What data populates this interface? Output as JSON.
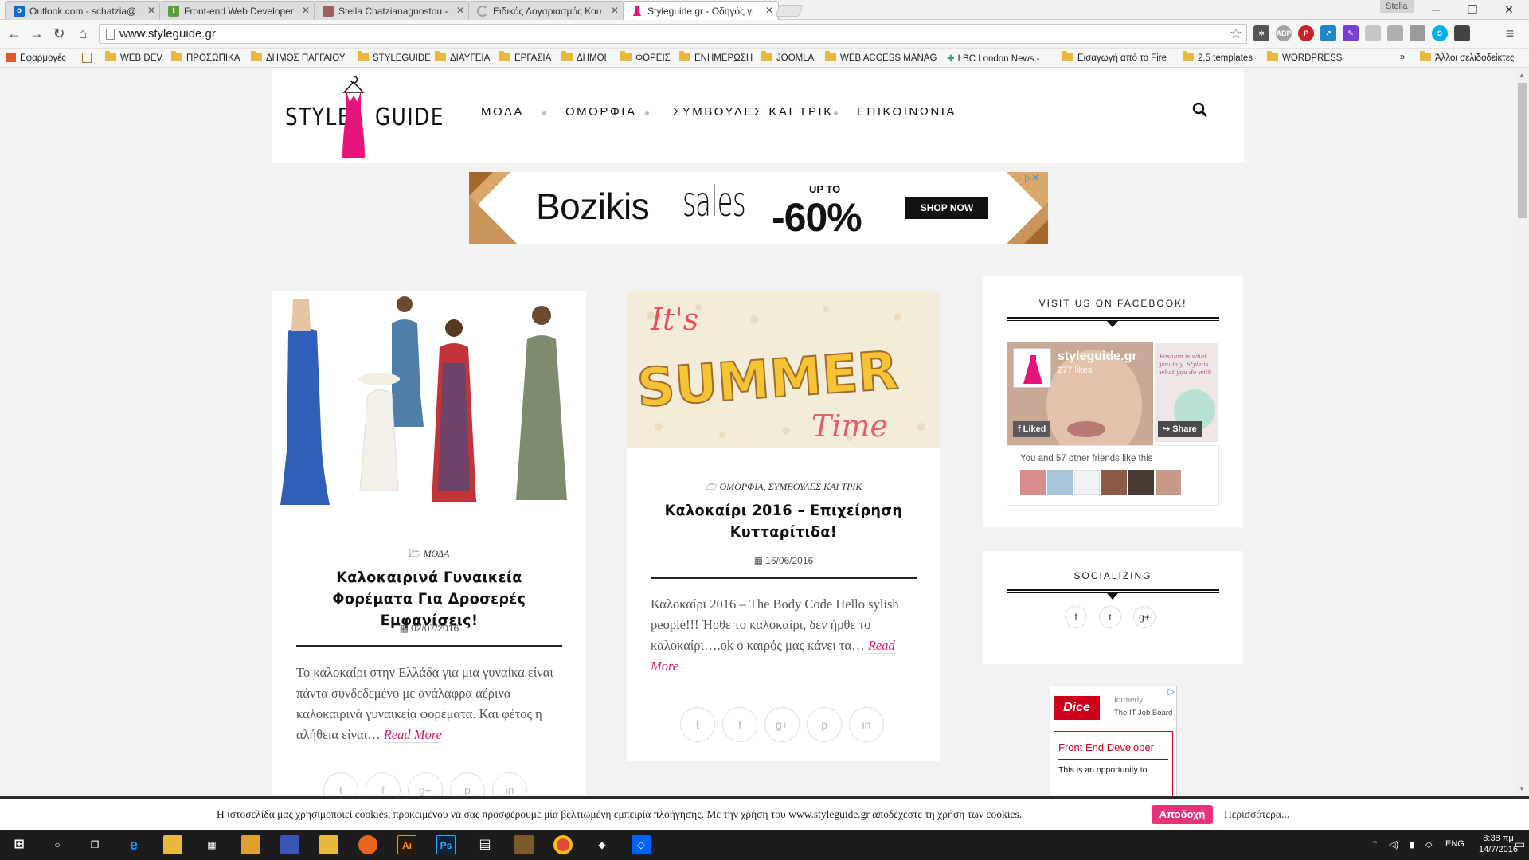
{
  "browser": {
    "tabs": [
      {
        "title": "Outlook.com - schatzia@",
        "fav_color": "#0a6ad0",
        "fav_glyph": "o"
      },
      {
        "title": "Front-end Web Developer",
        "fav_color": "#5a9e3a",
        "fav_glyph": "t"
      },
      {
        "title": "Stella Chatzianagnostou -",
        "fav_color": "#a06060",
        "fav_glyph": ""
      },
      {
        "title": "Ειδικός Λογαριασμός Κου",
        "fav_color": "#9aa0a6",
        "fav_glyph": ""
      },
      {
        "title": "Styleguide.gr - Οδηγός γι",
        "fav_color": "#e6157c",
        "fav_glyph": ""
      }
    ],
    "user_badge": "Stella",
    "url": "www.styleguide.gr",
    "bookmarks": [
      "Εφαρμογές",
      "WEB DEV",
      "ΠΡΟΣΩΠΙΚΑ",
      "ΔΗΜΟΣ ΠΑΓΓΑΙΟΥ",
      "STYLEGUIDE",
      "ΔΙΑΥΓΕΙΑ",
      "ΕΡΓΑΣΙΑ",
      "ΔΗΜΟΙ",
      "ΦΟΡΕΙΣ",
      "ΕΝΗΜΕΡΩΣΗ",
      "JOOMLA",
      "WEB ACCESS MANAG",
      "LBC London News - ",
      "Εισαγωγή από το Fire",
      "2.5 templates",
      "WORDPRESS"
    ],
    "bookmarks_overflow": "»",
    "other_bookmarks": "Άλλοι σελιδοδείκτες"
  },
  "site": {
    "logo_left": "STYLE",
    "logo_right": "GUIDE",
    "brand_color": "#e6157c",
    "nav": [
      "ΜΟΔΑ",
      "ΟΜΟΡΦΙΑ",
      "ΣΥΜΒΟΥΛΕΣ ΚΑΙ ΤΡΙΚ",
      "ΕΠΙΚΟΙΝΩΝΙΑ"
    ]
  },
  "banner": {
    "brand": "Bozikis",
    "sales": "sales",
    "upto": "UP TO",
    "discount": "-60%",
    "cta": "SHOP NOW"
  },
  "posts": [
    {
      "category": "ΜΟΔΑ",
      "title": "Καλοκαιρινά Γυναικεία Φορέματα Για Δροσερές Εμφανίσεις!",
      "date": "02/07/2016",
      "excerpt": "Το καλοκαίρι στην Ελλάδα για μια γυναίκα είναι πάντα συνδεδεμένο με ανάλαφρα αέρινα καλοκαιρινά γυναικεία φορέματα. Και φέτος η αλήθεια είναι…",
      "read_more": "Read More"
    },
    {
      "image_text_1": "It's",
      "image_text_2": "SUMMER",
      "image_text_3": "Time",
      "category": "ΟΜΟΡΦΙΑ, ΣΥΜΒΟΥΛΕΣ ΚΑΙ ΤΡΙΚ",
      "title": "Καλοκαίρι 2016 – Επιχείρηση Κυτταρίτιδα!",
      "date": "16/06/2016",
      "excerpt": "Καλοκαίρι 2016 – The Body Code Hello sylish people!!! Ήρθε το καλοκαίρι, δεν ήρθε το καλοκαίρι….ok ο καιρός μας κάνει τα…",
      "read_more": "Read More"
    }
  ],
  "sidebar": {
    "facebook_title": "VISIT US ON FACEBOOK!",
    "fb_page_name": "styleguide.gr",
    "fb_likes": "277 likes",
    "fb_liked": "Liked",
    "fb_share": "Share",
    "fb_quote": "Fashion is what you buy. Style is what you do with it.  -stylishgi",
    "fb_friends": "You and 57 other friends like this",
    "socializing_title": "SOCIALIZING",
    "ad_brand": "Dice",
    "ad_formerly": "formerly",
    "ad_board": "The IT Job Board",
    "ad_job": "Front End Developer",
    "ad_desc": "This is an opportunity to"
  },
  "cookie": {
    "text": "Η ιστοσελίδα μας χρησιμοποιεί cookies, προκειμένου να σας προσφέρουμε μία βελτιωμένη εμπειρία πλοήγησης. Με την χρήση του www.styleguide.gr αποδέχεστε τη χρήση των cookies.",
    "accept": "Αποδοχή",
    "more": "Περισσότερα..."
  },
  "taskbar": {
    "lang": "ENG",
    "time": "8:38 πμ",
    "date": "14/7/2016"
  }
}
